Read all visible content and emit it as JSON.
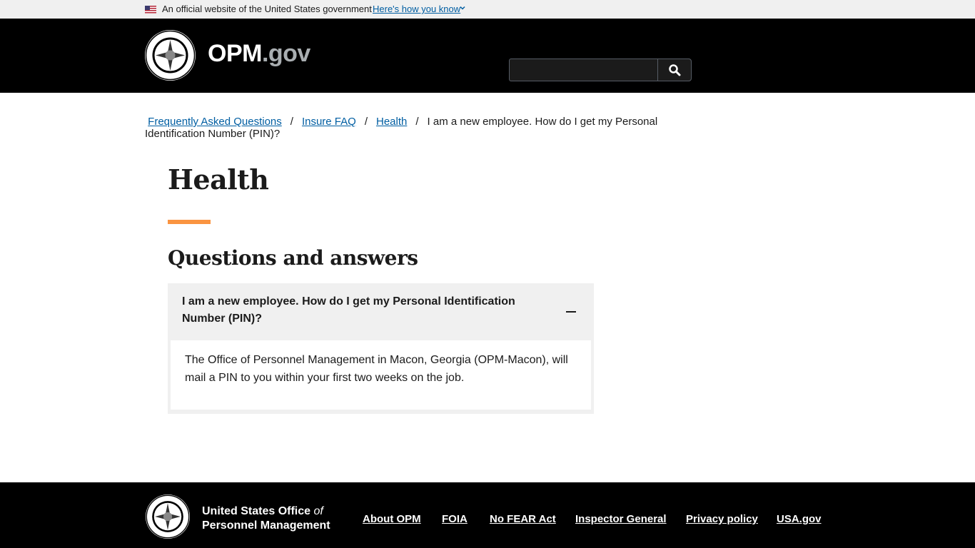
{
  "gov_banner": {
    "text": "An official website of the United States government",
    "link_label": "Here's how you know"
  },
  "header": {
    "site_name": "OPM",
    "site_suffix": ".gov",
    "search": {
      "value": "",
      "placeholder": "",
      "button_label": "Search"
    }
  },
  "breadcrumb": {
    "items": [
      {
        "label": "Frequently Asked Questions"
      },
      {
        "label": "Insure FAQ"
      },
      {
        "label": "Health"
      }
    ],
    "current": "I am a new employee. How do I get my Personal Identification Number (PIN)?",
    "separator": "/"
  },
  "main": {
    "title": "Health",
    "section_title": "Questions and answers",
    "accordion": {
      "question": "I am a new employee. How do I get my Personal Identification Number (PIN)?",
      "answer": "The Office of Personnel Management in Macon, Georgia (OPM-Macon), will mail a PIN to you within your first two weeks on the job.",
      "expanded": true
    }
  },
  "footer": {
    "agency_line1": "United States Office ",
    "agency_of": "of",
    "agency_line2": "Personnel Management",
    "links": [
      "About OPM",
      "FOIA",
      "No FEAR Act",
      "Inspector General",
      "Privacy policy",
      "USA.gov"
    ]
  },
  "colors": {
    "link": "#005ea2",
    "accent": "#fa9441",
    "header_bg": "#000000",
    "accordion_bg": "#f0f0f0"
  }
}
